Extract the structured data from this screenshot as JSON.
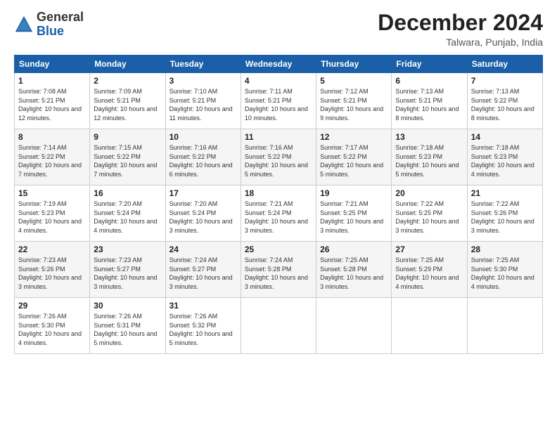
{
  "logo": {
    "general": "General",
    "blue": "Blue"
  },
  "title": "December 2024",
  "location": "Talwara, Punjab, India",
  "days_header": [
    "Sunday",
    "Monday",
    "Tuesday",
    "Wednesday",
    "Thursday",
    "Friday",
    "Saturday"
  ],
  "weeks": [
    [
      {
        "day": "1",
        "sunrise": "7:08 AM",
        "sunset": "5:21 PM",
        "daylight": "10 hours and 12 minutes."
      },
      {
        "day": "2",
        "sunrise": "7:09 AM",
        "sunset": "5:21 PM",
        "daylight": "10 hours and 12 minutes."
      },
      {
        "day": "3",
        "sunrise": "7:10 AM",
        "sunset": "5:21 PM",
        "daylight": "10 hours and 11 minutes."
      },
      {
        "day": "4",
        "sunrise": "7:11 AM",
        "sunset": "5:21 PM",
        "daylight": "10 hours and 10 minutes."
      },
      {
        "day": "5",
        "sunrise": "7:12 AM",
        "sunset": "5:21 PM",
        "daylight": "10 hours and 9 minutes."
      },
      {
        "day": "6",
        "sunrise": "7:13 AM",
        "sunset": "5:21 PM",
        "daylight": "10 hours and 8 minutes."
      },
      {
        "day": "7",
        "sunrise": "7:13 AM",
        "sunset": "5:22 PM",
        "daylight": "10 hours and 8 minutes."
      }
    ],
    [
      {
        "day": "8",
        "sunrise": "7:14 AM",
        "sunset": "5:22 PM",
        "daylight": "10 hours and 7 minutes."
      },
      {
        "day": "9",
        "sunrise": "7:15 AM",
        "sunset": "5:22 PM",
        "daylight": "10 hours and 7 minutes."
      },
      {
        "day": "10",
        "sunrise": "7:16 AM",
        "sunset": "5:22 PM",
        "daylight": "10 hours and 6 minutes."
      },
      {
        "day": "11",
        "sunrise": "7:16 AM",
        "sunset": "5:22 PM",
        "daylight": "10 hours and 5 minutes."
      },
      {
        "day": "12",
        "sunrise": "7:17 AM",
        "sunset": "5:22 PM",
        "daylight": "10 hours and 5 minutes."
      },
      {
        "day": "13",
        "sunrise": "7:18 AM",
        "sunset": "5:23 PM",
        "daylight": "10 hours and 5 minutes."
      },
      {
        "day": "14",
        "sunrise": "7:18 AM",
        "sunset": "5:23 PM",
        "daylight": "10 hours and 4 minutes."
      }
    ],
    [
      {
        "day": "15",
        "sunrise": "7:19 AM",
        "sunset": "5:23 PM",
        "daylight": "10 hours and 4 minutes."
      },
      {
        "day": "16",
        "sunrise": "7:20 AM",
        "sunset": "5:24 PM",
        "daylight": "10 hours and 4 minutes."
      },
      {
        "day": "17",
        "sunrise": "7:20 AM",
        "sunset": "5:24 PM",
        "daylight": "10 hours and 3 minutes."
      },
      {
        "day": "18",
        "sunrise": "7:21 AM",
        "sunset": "5:24 PM",
        "daylight": "10 hours and 3 minutes."
      },
      {
        "day": "19",
        "sunrise": "7:21 AM",
        "sunset": "5:25 PM",
        "daylight": "10 hours and 3 minutes."
      },
      {
        "day": "20",
        "sunrise": "7:22 AM",
        "sunset": "5:25 PM",
        "daylight": "10 hours and 3 minutes."
      },
      {
        "day": "21",
        "sunrise": "7:22 AM",
        "sunset": "5:26 PM",
        "daylight": "10 hours and 3 minutes."
      }
    ],
    [
      {
        "day": "22",
        "sunrise": "7:23 AM",
        "sunset": "5:26 PM",
        "daylight": "10 hours and 3 minutes."
      },
      {
        "day": "23",
        "sunrise": "7:23 AM",
        "sunset": "5:27 PM",
        "daylight": "10 hours and 3 minutes."
      },
      {
        "day": "24",
        "sunrise": "7:24 AM",
        "sunset": "5:27 PM",
        "daylight": "10 hours and 3 minutes."
      },
      {
        "day": "25",
        "sunrise": "7:24 AM",
        "sunset": "5:28 PM",
        "daylight": "10 hours and 3 minutes."
      },
      {
        "day": "26",
        "sunrise": "7:25 AM",
        "sunset": "5:28 PM",
        "daylight": "10 hours and 3 minutes."
      },
      {
        "day": "27",
        "sunrise": "7:25 AM",
        "sunset": "5:29 PM",
        "daylight": "10 hours and 4 minutes."
      },
      {
        "day": "28",
        "sunrise": "7:25 AM",
        "sunset": "5:30 PM",
        "daylight": "10 hours and 4 minutes."
      }
    ],
    [
      {
        "day": "29",
        "sunrise": "7:26 AM",
        "sunset": "5:30 PM",
        "daylight": "10 hours and 4 minutes."
      },
      {
        "day": "30",
        "sunrise": "7:26 AM",
        "sunset": "5:31 PM",
        "daylight": "10 hours and 5 minutes."
      },
      {
        "day": "31",
        "sunrise": "7:26 AM",
        "sunset": "5:32 PM",
        "daylight": "10 hours and 5 minutes."
      },
      null,
      null,
      null,
      null
    ]
  ]
}
